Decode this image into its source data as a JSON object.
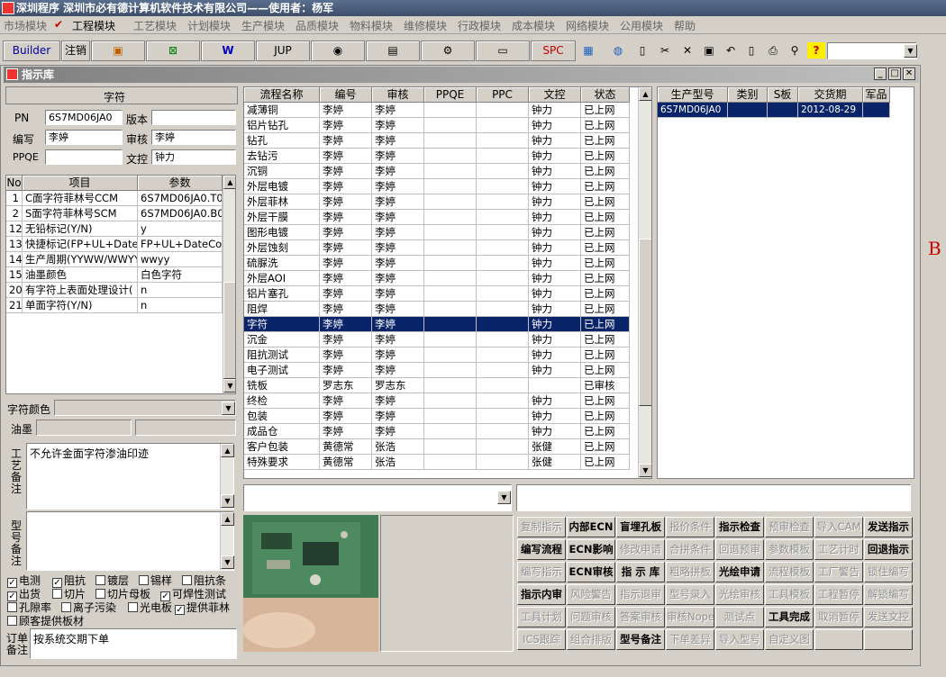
{
  "app": {
    "title": "深圳程序   深圳市必有德计算机软件技术有限公司——使用者：杨军"
  },
  "menu": [
    "市场模块",
    "工程模块",
    "工艺模块",
    "计划模块",
    "生产模块",
    "品质模块",
    "物料模块",
    "维修模块",
    "行政模块",
    "成本模块",
    "网络模块",
    "公用模块",
    "帮助"
  ],
  "toolbar": {
    "builder": "Builder",
    "logout": "注销",
    "jup": "JUP",
    "spc": "SPC"
  },
  "window": {
    "title": "指示库"
  },
  "left": {
    "section_title": "字符",
    "pn_label": "PN",
    "pn": "6S7MD06JA0",
    "version_label": "版本",
    "version": "",
    "author_label": "编写",
    "author": "李婷",
    "reviewer_label": "审核",
    "reviewer": "李婷",
    "ppqe_label": "PPQE",
    "ppqe": "",
    "doc_label": "文控",
    "doc": "钟力",
    "params_headers": [
      "No",
      "项目",
      "参数"
    ],
    "params": [
      [
        "1",
        "C面字符菲林号CCM",
        "6S7MD06JA0.T0"
      ],
      [
        "2",
        "S面字符菲林号SCM",
        "6S7MD06JA0.B0"
      ],
      [
        "12",
        "无铅标记(Y/N)",
        "y"
      ],
      [
        "13",
        "快捷标记(FP+UL+DateCo",
        "FP+UL+DateCode"
      ],
      [
        "14",
        "生产周期(YYWW/WWYY)",
        "wwyy"
      ],
      [
        "15",
        "油墨颜色",
        "白色字符"
      ],
      [
        "20",
        "有字符上表面处理设计(",
        "n"
      ],
      [
        "21",
        "单面字符(Y/N)",
        "n"
      ]
    ],
    "color_label": "字符颜色",
    "ink_label": "油墨",
    "craft_note_label": "工艺备注",
    "craft_note": "不允许金面字符渗油印迹",
    "model_note_label": "型号备注",
    "model_note": "",
    "checks": [
      {
        "label": "电测",
        "checked": true
      },
      {
        "label": "阻抗",
        "checked": true
      },
      {
        "label": "镀层",
        "checked": false
      },
      {
        "label": "锡样",
        "checked": false
      },
      {
        "label": "阻抗条",
        "checked": false
      },
      {
        "label": "出货",
        "checked": true
      },
      {
        "label": "切片",
        "checked": false
      },
      {
        "label": "切片母板",
        "checked": false
      },
      {
        "label": "可焊性测试",
        "checked": true
      },
      {
        "label": "孔隙率",
        "checked": false
      },
      {
        "label": "离子污染",
        "checked": false
      },
      {
        "label": "光电板",
        "checked": false
      },
      {
        "label": "提供菲林",
        "checked": true
      },
      {
        "label": "顾客提供板材",
        "checked": false
      }
    ],
    "order_note_label": "订单备注",
    "order_note": "按系统交期下单"
  },
  "process": {
    "headers": [
      "流程名称",
      "编号",
      "审核",
      "PPQE",
      "PPC",
      "文控",
      "状态"
    ],
    "rows": [
      [
        "减薄铜",
        "李婷",
        "李婷",
        "",
        "",
        "钟力",
        "已上网"
      ],
      [
        "铝片钻孔",
        "李婷",
        "李婷",
        "",
        "",
        "钟力",
        "已上网"
      ],
      [
        "钻孔",
        "李婷",
        "李婷",
        "",
        "",
        "钟力",
        "已上网"
      ],
      [
        "去钻污",
        "李婷",
        "李婷",
        "",
        "",
        "钟力",
        "已上网"
      ],
      [
        "沉铜",
        "李婷",
        "李婷",
        "",
        "",
        "钟力",
        "已上网"
      ],
      [
        "外层电镀",
        "李婷",
        "李婷",
        "",
        "",
        "钟力",
        "已上网"
      ],
      [
        "外层菲林",
        "李婷",
        "李婷",
        "",
        "",
        "钟力",
        "已上网"
      ],
      [
        "外层干膜",
        "李婷",
        "李婷",
        "",
        "",
        "钟力",
        "已上网"
      ],
      [
        "图形电镀",
        "李婷",
        "李婷",
        "",
        "",
        "钟力",
        "已上网"
      ],
      [
        "外层蚀刻",
        "李婷",
        "李婷",
        "",
        "",
        "钟力",
        "已上网"
      ],
      [
        "硫脲洗",
        "李婷",
        "李婷",
        "",
        "",
        "钟力",
        "已上网"
      ],
      [
        "外层AOI",
        "李婷",
        "李婷",
        "",
        "",
        "钟力",
        "已上网"
      ],
      [
        "铝片塞孔",
        "李婷",
        "李婷",
        "",
        "",
        "钟力",
        "已上网"
      ],
      [
        "阻焊",
        "李婷",
        "李婷",
        "",
        "",
        "钟力",
        "已上网"
      ],
      [
        "字符",
        "李婷",
        "李婷",
        "",
        "",
        "钟力",
        "已上网"
      ],
      [
        "沉金",
        "李婷",
        "李婷",
        "",
        "",
        "钟力",
        "已上网"
      ],
      [
        "阻抗测试",
        "李婷",
        "李婷",
        "",
        "",
        "钟力",
        "已上网"
      ],
      [
        "电子测试",
        "李婷",
        "李婷",
        "",
        "",
        "钟力",
        "已上网"
      ],
      [
        "铣板",
        "罗志东",
        "罗志东",
        "",
        "",
        "",
        "已审核"
      ],
      [
        "终检",
        "李婷",
        "李婷",
        "",
        "",
        "钟力",
        "已上网"
      ],
      [
        "包装",
        "李婷",
        "李婷",
        "",
        "",
        "钟力",
        "已上网"
      ],
      [
        "成品仓",
        "李婷",
        "李婷",
        "",
        "",
        "钟力",
        "已上网"
      ],
      [
        "客户包装",
        "黄德常",
        "张浩",
        "",
        "",
        "张健",
        "已上网"
      ],
      [
        "特殊要求",
        "黄德常",
        "张浩",
        "",
        "",
        "张健",
        "已上网"
      ]
    ],
    "selected_index": 14
  },
  "models": {
    "headers": [
      "生产型号",
      "类别",
      "S板",
      "交货期",
      "军品"
    ],
    "rows": [
      [
        "6S7MD06JA0",
        "",
        "",
        "2012-08-29",
        ""
      ]
    ]
  },
  "actions": [
    [
      {
        "t": "复制指示",
        "e": false
      },
      {
        "t": "内部ECN",
        "e": true
      },
      {
        "t": "盲埋孔板",
        "e": true
      },
      {
        "t": "报价条件",
        "e": false
      },
      {
        "t": "指示检查",
        "e": true
      },
      {
        "t": "预审检查",
        "e": false
      },
      {
        "t": "导入CAM",
        "e": false
      },
      {
        "t": "发送指示",
        "e": true
      }
    ],
    [
      {
        "t": "编写流程",
        "e": true
      },
      {
        "t": "ECN影响",
        "e": true
      },
      {
        "t": "修改申请",
        "e": false
      },
      {
        "t": "合拼条件",
        "e": false
      },
      {
        "t": "回退预审",
        "e": false
      },
      {
        "t": "参数模板",
        "e": false
      },
      {
        "t": "工艺计时",
        "e": false
      },
      {
        "t": "回退指示",
        "e": true
      }
    ],
    [
      {
        "t": "编写指示",
        "e": false
      },
      {
        "t": "ECN审核",
        "e": true
      },
      {
        "t": "指 示 库",
        "e": true
      },
      {
        "t": "粗略拼板",
        "e": false
      },
      {
        "t": "光绘申请",
        "e": true
      },
      {
        "t": "流程模板",
        "e": false
      },
      {
        "t": "工厂警告",
        "e": false
      },
      {
        "t": "锁住编写",
        "e": false
      }
    ],
    [
      {
        "t": "指示内审",
        "e": true
      },
      {
        "t": "风险警告",
        "e": false
      },
      {
        "t": "指示退审",
        "e": false
      },
      {
        "t": "型号录入",
        "e": false
      },
      {
        "t": "光绘审核",
        "e": false
      },
      {
        "t": "工具模板",
        "e": false
      },
      {
        "t": "工程暂停",
        "e": false
      },
      {
        "t": "解锁编写",
        "e": false
      }
    ],
    [
      {
        "t": "工具计划",
        "e": false
      },
      {
        "t": "问题审核",
        "e": false
      },
      {
        "t": "答案审核",
        "e": false
      },
      {
        "t": "审核Nope",
        "e": false
      },
      {
        "t": "测试点",
        "e": false
      },
      {
        "t": "工具完成",
        "e": true
      },
      {
        "t": "取消暂停",
        "e": false
      },
      {
        "t": "发送文控",
        "e": false
      }
    ],
    [
      {
        "t": "ICS跟踪",
        "e": false
      },
      {
        "t": "组合排版",
        "e": false
      },
      {
        "t": "型号备注",
        "e": true
      },
      {
        "t": "下单差异",
        "e": false
      },
      {
        "t": "导入型号",
        "e": false
      },
      {
        "t": "自定义图",
        "e": false
      },
      {
        "t": "",
        "e": false
      },
      {
        "t": "",
        "e": false
      }
    ]
  ],
  "right_edge_letter": "B",
  "colors": {
    "selection": "#0a246a",
    "chrome": "#d4d0c8",
    "red": "#cc0000"
  }
}
